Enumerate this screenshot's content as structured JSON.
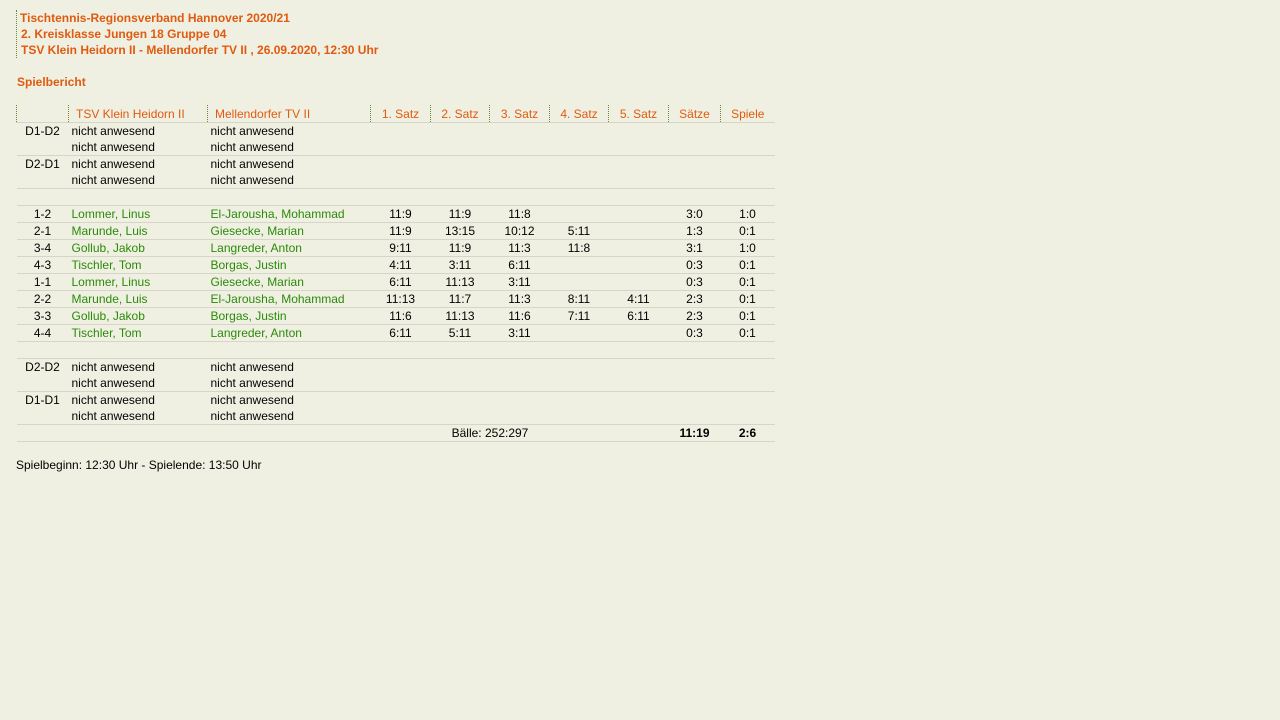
{
  "header": {
    "line1": "Tischtennis-Regionsverband Hannover 2020/21",
    "line2": "2. Kreisklasse Jungen 18 Gruppe 04",
    "line3": "TSV Klein Heidorn II - Mellendorfer TV II , 26.09.2020, 12:30 Uhr"
  },
  "section_title": "Spielbericht",
  "columns": [
    "",
    "TSV Klein Heidorn II",
    "Mellendorfer TV II",
    "1. Satz",
    "2. Satz",
    "3. Satz",
    "4. Satz",
    "5. Satz",
    "Sätze",
    "Spiele"
  ],
  "doubles_top": [
    {
      "pos": "D1-D2",
      "home": [
        "nicht anwesend",
        "nicht anwesend"
      ],
      "away": [
        "nicht anwesend",
        "nicht anwesend"
      ]
    },
    {
      "pos": "D2-D1",
      "home": [
        "nicht anwesend",
        "nicht anwesend"
      ],
      "away": [
        "nicht anwesend",
        "nicht anwesend"
      ]
    }
  ],
  "singles": [
    {
      "pos": "1-2",
      "home": "Lommer, Linus",
      "away": "El-Jarousha, Mohammad",
      "s1": "11:9",
      "s2": "11:9",
      "s3": "11:8",
      "s4": "",
      "s5": "",
      "saetze": "3:0",
      "spiele": "1:0"
    },
    {
      "pos": "2-1",
      "home": "Marunde, Luis",
      "away": "Giesecke, Marian",
      "s1": "11:9",
      "s2": "13:15",
      "s3": "10:12",
      "s4": "5:11",
      "s5": "",
      "saetze": "1:3",
      "spiele": "0:1"
    },
    {
      "pos": "3-4",
      "home": "Gollub, Jakob",
      "away": "Langreder, Anton",
      "s1": "9:11",
      "s2": "11:9",
      "s3": "11:3",
      "s4": "11:8",
      "s5": "",
      "saetze": "3:1",
      "spiele": "1:0"
    },
    {
      "pos": "4-3",
      "home": "Tischler, Tom",
      "away": "Borgas, Justin",
      "s1": "4:11",
      "s2": "3:11",
      "s3": "6:11",
      "s4": "",
      "s5": "",
      "saetze": "0:3",
      "spiele": "0:1"
    },
    {
      "pos": "1-1",
      "home": "Lommer, Linus",
      "away": "Giesecke, Marian",
      "s1": "6:11",
      "s2": "11:13",
      "s3": "3:11",
      "s4": "",
      "s5": "",
      "saetze": "0:3",
      "spiele": "0:1"
    },
    {
      "pos": "2-2",
      "home": "Marunde, Luis",
      "away": "El-Jarousha, Mohammad",
      "s1": "11:13",
      "s2": "11:7",
      "s3": "11:3",
      "s4": "8:11",
      "s5": "4:11",
      "saetze": "2:3",
      "spiele": "0:1"
    },
    {
      "pos": "3-3",
      "home": "Gollub, Jakob",
      "away": "Borgas, Justin",
      "s1": "11:6",
      "s2": "11:13",
      "s3": "11:6",
      "s4": "7:11",
      "s5": "6:11",
      "saetze": "2:3",
      "spiele": "0:1"
    },
    {
      "pos": "4-4",
      "home": "Tischler, Tom",
      "away": "Langreder, Anton",
      "s1": "6:11",
      "s2": "5:11",
      "s3": "3:11",
      "s4": "",
      "s5": "",
      "saetze": "0:3",
      "spiele": "0:1"
    }
  ],
  "doubles_bottom": [
    {
      "pos": "D2-D2",
      "home": [
        "nicht anwesend",
        "nicht anwesend"
      ],
      "away": [
        "nicht anwesend",
        "nicht anwesend"
      ]
    },
    {
      "pos": "D1-D1",
      "home": [
        "nicht anwesend",
        "nicht anwesend"
      ],
      "away": [
        "nicht anwesend",
        "nicht anwesend"
      ]
    }
  ],
  "totals": {
    "balls": "Bälle: 252:297",
    "saetze": "11:19",
    "spiele": "2:6"
  },
  "footer": "Spielbeginn: 12:30 Uhr - Spielende: 13:50 Uhr",
  "colors": {
    "accent": "#e05a10",
    "player": "#2a8a0a",
    "background": "#f0f0e2"
  }
}
